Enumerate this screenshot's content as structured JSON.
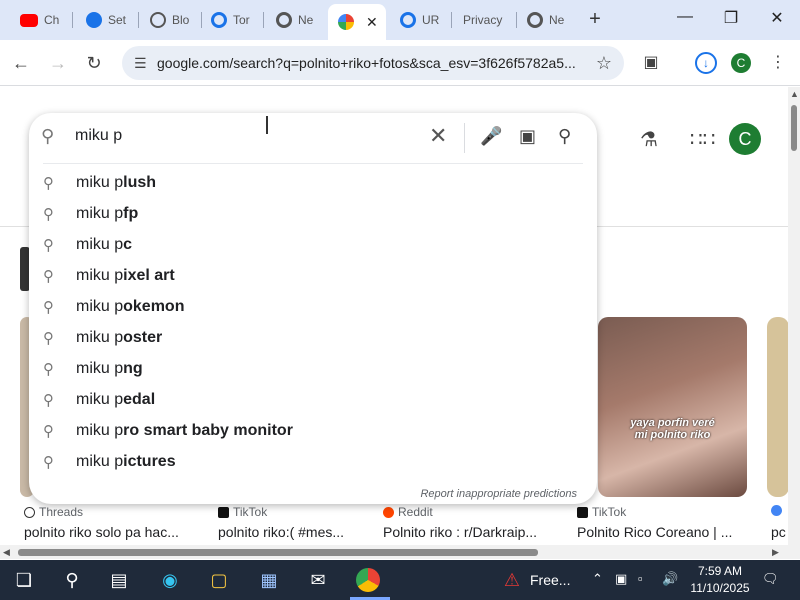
{
  "browser": {
    "tabs": [
      {
        "label": "Ch",
        "icon": "youtube-icon",
        "color": "#ff0000"
      },
      {
        "label": "Set",
        "icon": "gear-icon",
        "color": "#1a73e8"
      },
      {
        "label": "Blo",
        "icon": "globe-icon",
        "color": "#555555"
      },
      {
        "label": "Tor",
        "icon": "torrent-icon",
        "color": "#1a73e8"
      },
      {
        "label": "Ne",
        "icon": "chrome-icon",
        "color": "#555555"
      },
      {
        "label": "",
        "icon": "google-icon",
        "color": "#4285f4",
        "active": true
      },
      {
        "label": "UR",
        "icon": "url-icon",
        "color": "#1a73e8"
      },
      {
        "label": "Privacy",
        "icon": "blank-icon",
        "color": "#dee7f8"
      },
      {
        "label": "Ne",
        "icon": "chrome-icon",
        "color": "#555555"
      }
    ],
    "new_tab": "+",
    "window": {
      "minimize": "—",
      "maximize": "❐",
      "close": "✕"
    },
    "url": "google.com/search?q=polnito+riko+fotos&sca_esv=3f626f5782a5...",
    "profile_initial": "C",
    "accent": "#1a73e8"
  },
  "search": {
    "query": "miku p",
    "suggestions": [
      {
        "prefix": "miku p",
        "completion": "lush"
      },
      {
        "prefix": "miku p",
        "completion": "fp"
      },
      {
        "prefix": "miku p",
        "completion": "c"
      },
      {
        "prefix": "miku p",
        "completion": "ixel art"
      },
      {
        "prefix": "miku p",
        "completion": "okemon"
      },
      {
        "prefix": "miku p",
        "completion": "oster"
      },
      {
        "prefix": "miku p",
        "completion": "ng"
      },
      {
        "prefix": "miku p",
        "completion": "edal"
      },
      {
        "prefix": "miku p",
        "completion": "ro smart baby monitor"
      },
      {
        "prefix": "miku p",
        "completion": "ictures"
      }
    ],
    "report_link": "Report inappropriate predictions"
  },
  "page": {
    "avatar_initial": "C",
    "thumb_caption": "yaya porfin veré\nmi polnito riko",
    "results": [
      {
        "source": "Threads",
        "title": "polnito riko solo pa hac..."
      },
      {
        "source": "TikTok",
        "title": "polnito riko:( #mes..."
      },
      {
        "source": "Reddit",
        "title": "Polnito riko : r/Darkraip..."
      },
      {
        "source": "TikTok",
        "title": "Polnito Rico Coreano | ..."
      },
      {
        "source": "",
        "title": "pc"
      }
    ]
  },
  "taskbar": {
    "notification_label": "Free...",
    "time": "7:59 AM",
    "date": "11/10/2025"
  }
}
